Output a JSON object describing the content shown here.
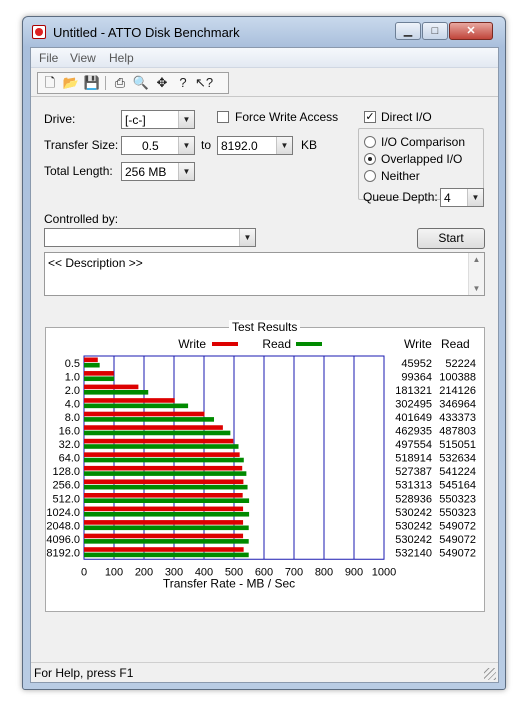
{
  "window": {
    "title": "Untitled - ATTO Disk Benchmark"
  },
  "menu": {
    "file": "File",
    "view": "View",
    "help": "Help"
  },
  "toolbar": {
    "icons": [
      "new-document-icon",
      "open-folder-icon",
      "save-disk-icon",
      "print-icon",
      "print-preview-icon",
      "move-cross-icon",
      "help-question-icon",
      "context-help-icon"
    ]
  },
  "form": {
    "drive_label": "Drive:",
    "drive_value": "[-c-]",
    "force_write_label": "Force Write Access",
    "force_write_checked": false,
    "direct_io_label": "Direct I/O",
    "direct_io_checked": true,
    "transfer_size_label": "Transfer Size:",
    "transfer_from": "0.5",
    "to_label": "to",
    "transfer_to": "8192.0",
    "kb_label": "KB",
    "total_length_label": "Total Length:",
    "total_length_value": "256 MB",
    "io_comparison_label": "I/O Comparison",
    "overlapped_io_label": "Overlapped I/O",
    "neither_label": "Neither",
    "selected_mode": "Overlapped I/O",
    "queue_depth_label": "Queue Depth:",
    "queue_depth_value": "4",
    "controlled_by_label": "Controlled by:",
    "controlled_by_value": "",
    "start_label": "Start",
    "description_text": "<< Description >>"
  },
  "results": {
    "title": "Test Results",
    "write_legend": "Write",
    "read_legend": "Read",
    "write_col": "Write",
    "read_col": "Read",
    "colors": {
      "write": "#dd0000",
      "read": "#008a00",
      "grid": "#1a1ab0"
    }
  },
  "chart_data": {
    "type": "bar",
    "orientation": "horizontal",
    "xlabel": "Transfer Rate - MB / Sec",
    "xlim": [
      0,
      1000
    ],
    "xticks": [
      "0",
      "100",
      "200",
      "300",
      "400",
      "500",
      "600",
      "700",
      "800",
      "900",
      "1000"
    ],
    "categories": [
      "0.5",
      "1.0",
      "2.0",
      "4.0",
      "8.0",
      "16.0",
      "32.0",
      "64.0",
      "128.0",
      "256.0",
      "512.0",
      "1024.0",
      "2048.0",
      "4096.0",
      "8192.0"
    ],
    "series": [
      {
        "name": "Write",
        "values": [
          45952,
          99364,
          181321,
          302495,
          401649,
          462935,
          497554,
          518914,
          527387,
          531313,
          528936,
          530242,
          530242,
          530242,
          532140
        ],
        "color": "#dd0000"
      },
      {
        "name": "Read",
        "values": [
          52224,
          100388,
          214126,
          346964,
          433373,
          487803,
          515051,
          532634,
          541224,
          545164,
          550323,
          550323,
          549072,
          549072,
          549072
        ],
        "color": "#008a00"
      }
    ]
  },
  "status": {
    "text": "For Help, press F1"
  }
}
